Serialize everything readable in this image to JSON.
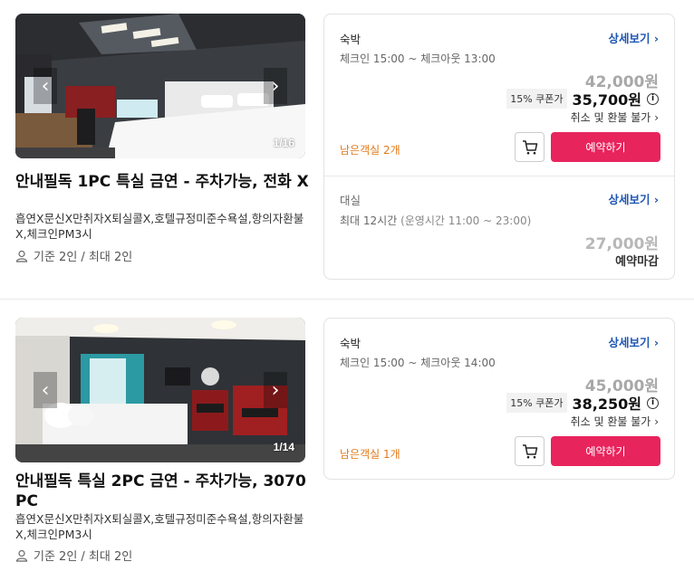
{
  "rooms": [
    {
      "photo_counter": "1/16",
      "title": "안내필독 1PC 특실 금연 - 주차가능, 전화 X",
      "policy": "흡연X문신X만취자X퇴실콜X,호텔규정미준수욕설,항의자환불X,체크인PM3시",
      "capacity": "기준 2인 / 최대 2인",
      "stay": {
        "type": "숙박",
        "details": "상세보기",
        "times": "체크인 15:00 ~ 체크아웃 13:00",
        "original_price": "42,000원",
        "coupon": "15% 쿠폰가",
        "final_price": "35,700원",
        "refund": "취소 및 환불 불가",
        "rooms_left": "남은객실 2개",
        "reserve": "예약하기"
      },
      "dayuse": {
        "type": "대실",
        "details": "상세보기",
        "times": "최대 12시간",
        "times_sub": "(운영시간 11:00 ~ 23:00)",
        "original_price": "27,000원",
        "status": "예약마감"
      }
    },
    {
      "photo_counter": "1/14",
      "title": "안내필독 특실 2PC 금연 - 주차가능, 3070 PC",
      "policy": "흡연X문신X만취자X퇴실콜X,호텔규정미준수욕설,항의자환불X,체크인PM3시",
      "capacity": "기준 2인 / 최대 2인",
      "stay": {
        "type": "숙박",
        "details": "상세보기",
        "times": "체크인 15:00 ~ 체크아웃 14:00",
        "original_price": "45,000원",
        "coupon": "15% 쿠폰가",
        "final_price": "38,250원",
        "refund": "취소 및 환불 불가",
        "rooms_left": "남은객실 1개",
        "reserve": "예약하기"
      }
    }
  ],
  "colors": {
    "accent": "#e8245d",
    "link": "#1e55b4",
    "rooms_left": "#e07a1b"
  },
  "icons": {
    "person": "person-icon",
    "cart": "cart-icon",
    "info": "info-icon",
    "chevron": "chevron-right-icon"
  }
}
